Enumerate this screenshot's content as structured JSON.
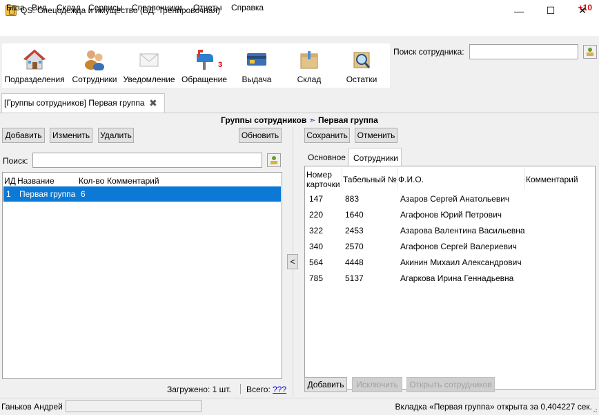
{
  "window": {
    "title": "QS: Спецодежда и имущество (БД: Тренировочная)",
    "minimize_glyph": "—",
    "maximize_glyph": "☐",
    "close_glyph": "✕"
  },
  "menu": {
    "items": [
      "База",
      "Вид",
      "Склад",
      "Сервисы",
      "Справочники",
      "Отчеты",
      "Справка"
    ],
    "badge": "+10"
  },
  "toolbar": {
    "buttons": [
      {
        "label": "Подразделения",
        "icon": "house-icon"
      },
      {
        "label": "Сотрудники",
        "icon": "people-icon"
      },
      {
        "label": "Уведомление",
        "icon": "envelope-icon"
      },
      {
        "label": "Обращение",
        "icon": "mailbox-icon"
      },
      {
        "label": "Выдача",
        "icon": "card-icon"
      },
      {
        "label": "Склад",
        "icon": "box-icon"
      },
      {
        "label": "Остатки",
        "icon": "magnifier-box-icon"
      }
    ],
    "obrashenie_badge": "3"
  },
  "employee_search": {
    "label": "Поиск сотрудника:",
    "value": ""
  },
  "doc_tab": {
    "label": "[Группы сотрудников] Первая группа",
    "close_glyph": "✖"
  },
  "breadcrumb": {
    "parent": "Группы сотрудников",
    "arrow": "➣",
    "current": "Первая группа"
  },
  "left": {
    "buttons": {
      "add": "Добавить",
      "edit": "Изменить",
      "delete": "Удалить",
      "refresh": "Обновить"
    },
    "search_label": "Поиск:",
    "search_value": "",
    "columns": [
      "ИД",
      "Название",
      "Кол-во",
      "Комментарий"
    ],
    "rows": [
      {
        "id": "1",
        "name": "Первая группа",
        "count": "6",
        "comment": ""
      }
    ],
    "loaded": "Загружено: 1 шт.",
    "total_label": "Всего:",
    "total_link": "???"
  },
  "splitter": {
    "glyph": "<"
  },
  "right": {
    "buttons": {
      "save": "Сохранить",
      "cancel": "Отменить"
    },
    "tabs": [
      "Основное",
      "Сотрудники"
    ],
    "columns": {
      "card_line1": "Номер",
      "card_line2": "карточки",
      "tab_no": "Табельный №",
      "fio": "Ф.И.О.",
      "comment": "Комментарий"
    },
    "rows": [
      {
        "card": "147",
        "tab": "883",
        "fio": "Азаров Сергей Анатольевич"
      },
      {
        "card": "220",
        "tab": "1640",
        "fio": "Агафонов Юрий Петрович"
      },
      {
        "card": "322",
        "tab": "2453",
        "fio": "Азарова Валентина Васильевна"
      },
      {
        "card": "340",
        "tab": "2570",
        "fio": "Агафонов Сергей Валериевич"
      },
      {
        "card": "564",
        "tab": "4448",
        "fio": "Акинин Михаил Александрович"
      },
      {
        "card": "785",
        "tab": "5137",
        "fio": "Агаркова Ирина Геннадьевна"
      }
    ],
    "bottom_buttons": {
      "add": "Добавить",
      "exclude": "Исключить",
      "open": "Открыть сотрудников"
    }
  },
  "status": {
    "user": "Ганьков Андрей",
    "message": "Вкладка «Первая группа» открыта за 0,404227 сек."
  }
}
